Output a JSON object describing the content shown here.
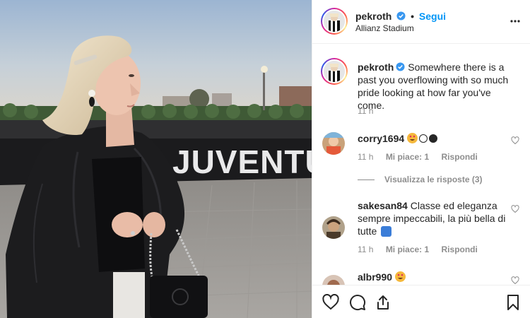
{
  "post": {
    "username": "pekroth",
    "follow_label": "Segui",
    "separator": "•",
    "location": "Allianz Stadium",
    "photo_sign_text": "JUVENTUS",
    "caption": {
      "username": "pekroth",
      "text": "Somewhere there is a past you overflowing with so much pride looking at how far you've come.",
      "time": "11 h"
    }
  },
  "comments": [
    {
      "username": "corry1694",
      "text": "",
      "emoji": [
        "heart-eyes-emoji",
        "white-circle-emoji",
        "black-circle-emoji"
      ],
      "time": "11 h",
      "likes": "Mi piace: 1",
      "reply": "Rispondi"
    },
    {
      "username": "sakesan84",
      "text": "Classe ed eleganza sempre impeccabili, la più bella di tutte",
      "emoji": [
        "blue-square-emoji"
      ],
      "time": "11 h",
      "likes": "Mi piace: 1",
      "reply": "Rispondi"
    },
    {
      "username": "albr990",
      "text": "",
      "emoji": [
        "heart-eyes-emoji"
      ]
    }
  ],
  "view_replies": "Visualizza le risposte (3)",
  "icons": {
    "more": "more-options-icon",
    "like": "heart-icon",
    "comment": "comment-icon",
    "share": "share-icon",
    "save": "bookmark-icon",
    "verified": "verified-badge-icon"
  },
  "colors": {
    "accent": "#0095f6",
    "verified": "#3897f0",
    "text": "#262626",
    "muted": "#8e8e8e"
  }
}
